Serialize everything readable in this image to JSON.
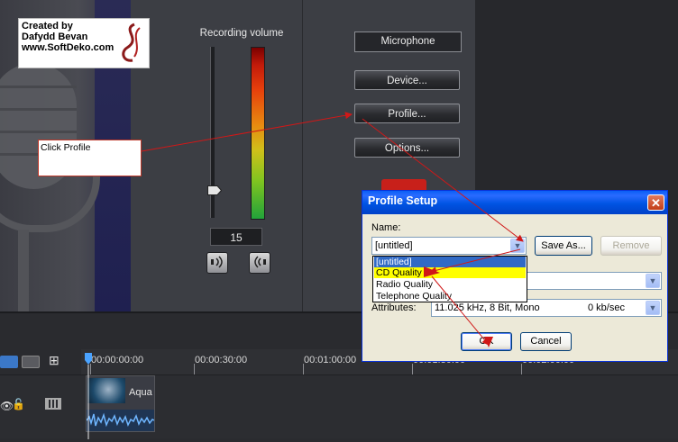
{
  "credit": {
    "line1": "Created by",
    "line2": "Dafydd Bevan",
    "line3": "www.SoftDeko.com"
  },
  "recording": {
    "label": "Recording volume",
    "volume_value": "15",
    "volume_level": 0.15
  },
  "side_panel": {
    "source_label": "Microphone",
    "device_button": "Device...",
    "profile_button": "Profile...",
    "options_button": "Options..."
  },
  "annotation": {
    "text": "Click Profile"
  },
  "dialog": {
    "title": "Profile Setup",
    "close_glyph": "✕",
    "name_label": "Name:",
    "name_value": "[untitled]",
    "save_as_button": "Save As...",
    "remove_button": "Remove",
    "dropdown_options": [
      "[untitled]",
      "CD Quality",
      "Radio Quality",
      "Telephone Quality"
    ],
    "attributes_label": "Attributes:",
    "attributes_value": "11.025 kHz, 8 Bit, Mono",
    "attributes_rate": "0 kb/sec",
    "ok_button": "OK",
    "cancel_button": "Cancel"
  },
  "timeline": {
    "markers": [
      "00:00:00:00",
      "00:00:30:00",
      "00:01:00:00",
      "00:01:30:00",
      "00:02:00:00"
    ],
    "clip_title": "Aqua"
  },
  "icons": {
    "speaker_left": "speaker-wave-icon",
    "speaker_right": "speaker-outgoing-icon",
    "eye": "eye-icon",
    "lock": "lock-icon",
    "film": "film-strip-icon"
  },
  "colors": {
    "dialog_title_blue": "#0054e3",
    "annotation_red": "#d01818",
    "selection_blue": "#316ac5",
    "highlight_yellow": "#ffff00"
  }
}
